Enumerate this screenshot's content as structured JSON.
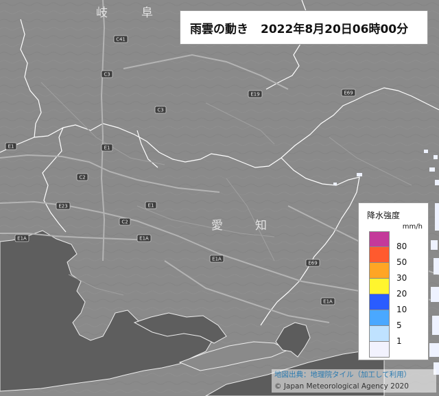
{
  "header": {
    "title": "雨雲の動き",
    "timestamp": "2022年8月20日06時00分"
  },
  "legend": {
    "title": "降水強度",
    "unit": "mm/h",
    "levels": [
      {
        "label": "80",
        "color": "#c4399a"
      },
      {
        "label": "50",
        "color": "#ff5a2e"
      },
      {
        "label": "30",
        "color": "#ffa524"
      },
      {
        "label": "20",
        "color": "#fff52e"
      },
      {
        "label": "10",
        "color": "#2a5cff"
      },
      {
        "label": "5",
        "color": "#4aa8ff"
      },
      {
        "label": "1",
        "color": "#bfe2ff"
      },
      {
        "label": "",
        "color": "#f2f2fe"
      }
    ]
  },
  "attribution": {
    "source": "地図出典：地理院タイル（加工して利用）",
    "copyright": "© Japan Meteorological Agency 2020"
  },
  "map_labels": {
    "gifu_1": "岐",
    "gifu_2": "阜",
    "aichi_1": "愛",
    "aichi_2": "知"
  },
  "road_labels": [
    "C3",
    "C3",
    "E1",
    "C2",
    "C2",
    "E1",
    "E1A",
    "E23",
    "E1A",
    "E1A",
    "E69",
    "E69",
    "E19",
    "E1",
    "C41",
    "E1A"
  ],
  "colors": {
    "land": "#8a8a8a",
    "sea": "#5c5c5c",
    "prefecture_border": "#ffffff",
    "rain_light": "#eef2ff"
  }
}
